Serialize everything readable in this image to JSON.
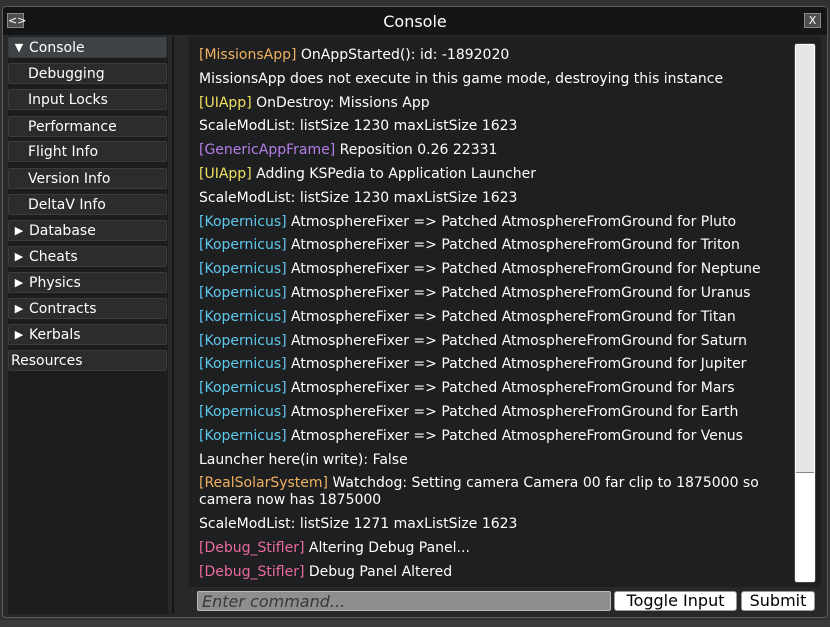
{
  "window": {
    "title": "Console",
    "left_button": "<>",
    "close_button": "X"
  },
  "sidebar": {
    "items": [
      {
        "label": "Console",
        "arrow": "▼",
        "level": "root",
        "active": true
      },
      {
        "label": "Debugging",
        "arrow": "",
        "level": "sub"
      },
      {
        "label": "Input Locks",
        "arrow": "",
        "level": "sub"
      },
      {
        "label": "Performance",
        "arrow": "",
        "level": "sub"
      },
      {
        "label": "Flight Info",
        "arrow": "",
        "level": "sub"
      },
      {
        "label": "Version Info",
        "arrow": "",
        "level": "sub"
      },
      {
        "label": "DeltaV Info",
        "arrow": "",
        "level": "sub"
      },
      {
        "label": "Database",
        "arrow": "▶",
        "level": "root"
      },
      {
        "label": "Cheats",
        "arrow": "▶",
        "level": "root"
      },
      {
        "label": "Physics",
        "arrow": "▶",
        "level": "root"
      },
      {
        "label": "Contracts",
        "arrow": "▶",
        "level": "root"
      },
      {
        "label": "Kerbals",
        "arrow": "▶",
        "level": "root"
      },
      {
        "label": "Resources",
        "arrow": "",
        "level": "plain"
      }
    ]
  },
  "log": {
    "entries": [
      {
        "tag": "[MissionsApp]",
        "color": "#f0b060",
        "text": " OnAppStarted(): id: -1892020"
      },
      {
        "tag": "",
        "color": "",
        "text": "MissionsApp does not execute in this game mode, destroying this instance"
      },
      {
        "tag": "[UIApp]",
        "color": "#f0e060",
        "text": " OnDestroy: Missions App"
      },
      {
        "tag": "",
        "color": "",
        "text": "ScaleModList: listSize 1230 maxListSize 1623"
      },
      {
        "tag": "[GenericAppFrame]",
        "color": "#b57ee8",
        "text": " Reposition 0.26 22331"
      },
      {
        "tag": "[UIApp]",
        "color": "#f0e060",
        "text": " Adding KSPedia to Application Launcher"
      },
      {
        "tag": "",
        "color": "",
        "text": "ScaleModList: listSize 1230 maxListSize 1623"
      },
      {
        "tag": "[Kopernicus]",
        "color": "#5ec8ec",
        "text": " AtmosphereFixer => Patched AtmosphereFromGround for Pluto"
      },
      {
        "tag": "[Kopernicus]",
        "color": "#5ec8ec",
        "text": " AtmosphereFixer => Patched AtmosphereFromGround for Triton"
      },
      {
        "tag": "[Kopernicus]",
        "color": "#5ec8ec",
        "text": " AtmosphereFixer => Patched AtmosphereFromGround for Neptune"
      },
      {
        "tag": "[Kopernicus]",
        "color": "#5ec8ec",
        "text": " AtmosphereFixer => Patched AtmosphereFromGround for Uranus"
      },
      {
        "tag": "[Kopernicus]",
        "color": "#5ec8ec",
        "text": " AtmosphereFixer => Patched AtmosphereFromGround for Titan"
      },
      {
        "tag": "[Kopernicus]",
        "color": "#5ec8ec",
        "text": " AtmosphereFixer => Patched AtmosphereFromGround for Saturn"
      },
      {
        "tag": "[Kopernicus]",
        "color": "#5ec8ec",
        "text": " AtmosphereFixer => Patched AtmosphereFromGround for Jupiter"
      },
      {
        "tag": "[Kopernicus]",
        "color": "#5ec8ec",
        "text": " AtmosphereFixer => Patched AtmosphereFromGround for Mars"
      },
      {
        "tag": "[Kopernicus]",
        "color": "#5ec8ec",
        "text": " AtmosphereFixer => Patched AtmosphereFromGround for Earth"
      },
      {
        "tag": "[Kopernicus]",
        "color": "#5ec8ec",
        "text": " AtmosphereFixer => Patched AtmosphereFromGround for Venus"
      },
      {
        "tag": "",
        "color": "",
        "text": "Launcher here(in write): False"
      },
      {
        "tag": "[RealSolarSystem]",
        "color": "#f0b060",
        "text": " Watchdog: Setting camera Camera 00 far clip to 1875000 so camera now has 1875000"
      },
      {
        "tag": "",
        "color": "",
        "text": "ScaleModList: listSize 1271 maxListSize 1623"
      },
      {
        "tag": "[Debug_Stifler]",
        "color": "#ec6aa0",
        "text": " Altering Debug Panel..."
      },
      {
        "tag": "[Debug_Stifler]",
        "color": "#ec6aa0",
        "text": " Debug Panel Altered"
      }
    ]
  },
  "command": {
    "placeholder": "Enter command...",
    "value": ""
  },
  "buttons": {
    "toggle_input": "Toggle Input",
    "submit": "Submit"
  }
}
